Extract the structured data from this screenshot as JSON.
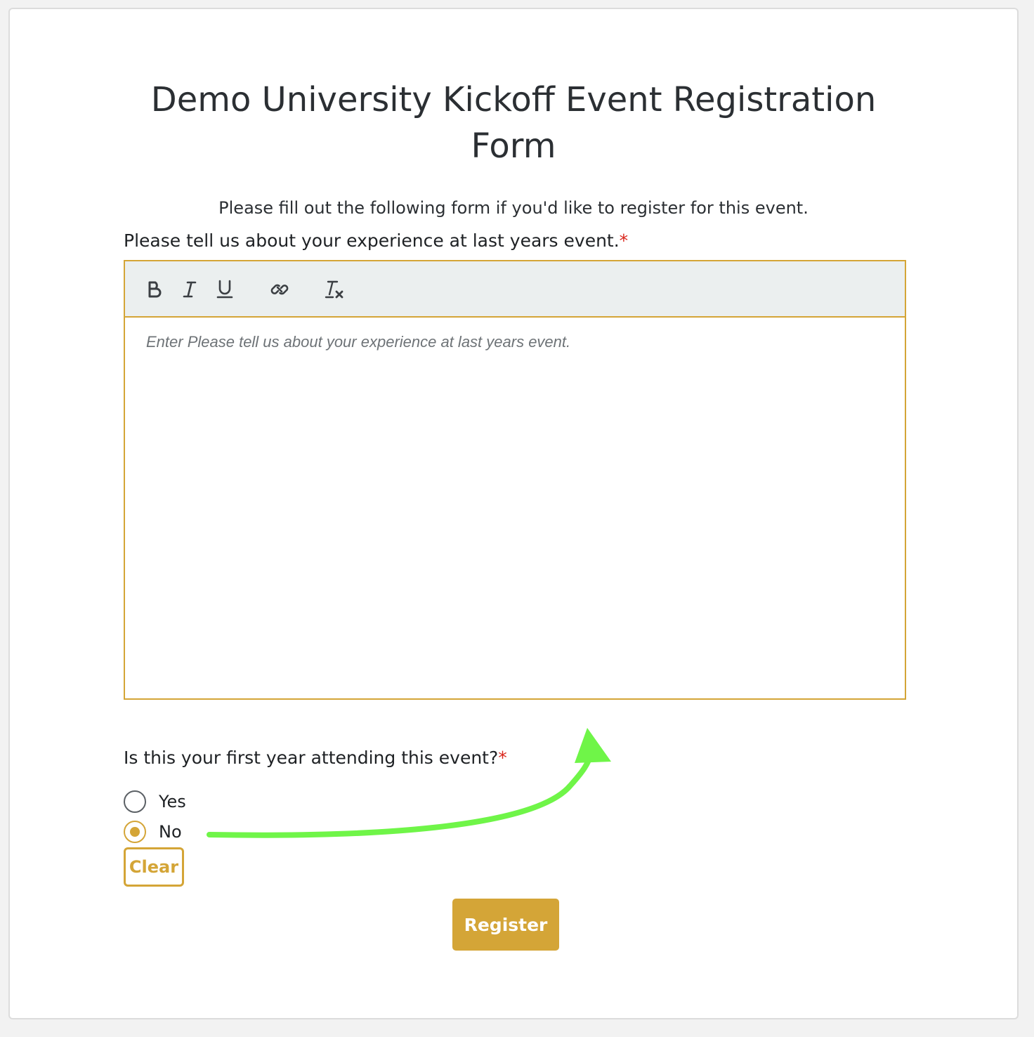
{
  "form": {
    "title": "Demo University Kickoff Event Registration Form",
    "subtitle": "Please fill out the following form if you'd like to register for this event."
  },
  "question1": {
    "label": "Please tell us about your experience at last years event.",
    "required_mark": "*",
    "placeholder": "Enter Please tell us about your experience at last years event.",
    "toolbar_icons": [
      "bold-icon",
      "italic-icon",
      "underline-icon",
      "link-icon",
      "clear-format-icon"
    ]
  },
  "question2": {
    "label": "Is this your first year attending this event?",
    "required_mark": "*",
    "options": [
      {
        "label": "Yes",
        "checked": false
      },
      {
        "label": "No",
        "checked": true
      }
    ],
    "clear_label": "Clear"
  },
  "register_label": "Register",
  "colors": {
    "accent": "#d4a537",
    "required": "#d9261c",
    "annotation_arrow": "#6ff548",
    "toolbar_bg": "#ebefef"
  }
}
